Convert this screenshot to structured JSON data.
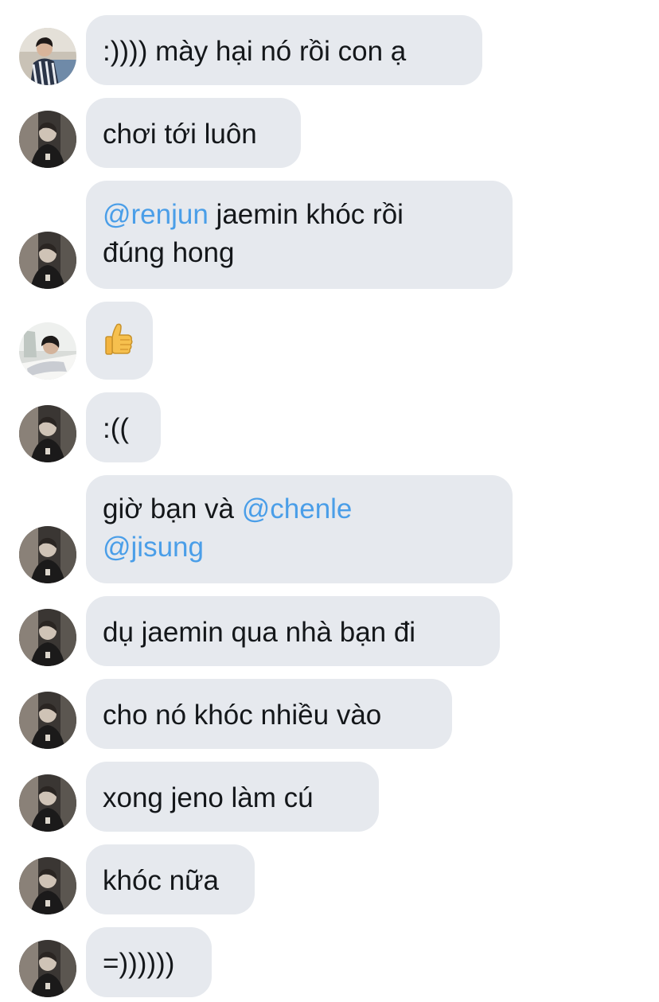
{
  "messages": [
    {
      "avatar": "avatar-user-a",
      "segments": [
        {
          "text": ":)))) mày hại nó rồi con ạ"
        }
      ]
    },
    {
      "avatar": "avatar-user-b",
      "segments": [
        {
          "text": "chơi tới luôn"
        }
      ]
    },
    {
      "avatar": "avatar-user-b",
      "segments": [
        {
          "text": "@renjun",
          "mention": true
        },
        {
          "text": " jaemin khóc rồi"
        },
        {
          "text": "đúng hong",
          "newline": true
        }
      ]
    },
    {
      "avatar": "avatar-user-c",
      "segments": [
        {
          "emoji": "thumbs-up-icon"
        }
      ]
    },
    {
      "avatar": "avatar-user-b",
      "segments": [
        {
          "text": ":(("
        }
      ]
    },
    {
      "avatar": "avatar-user-b",
      "segments": [
        {
          "text": "giờ bạn và "
        },
        {
          "text": "@chenle",
          "mention": true
        },
        {
          "text": "@jisung",
          "mention": true,
          "newline": true
        }
      ]
    },
    {
      "avatar": "avatar-user-b",
      "segments": [
        {
          "text": "dụ jaemin qua nhà bạn đi"
        }
      ]
    },
    {
      "avatar": "avatar-user-b",
      "segments": [
        {
          "text": "cho nó khóc nhiều vào"
        }
      ]
    },
    {
      "avatar": "avatar-user-b",
      "segments": [
        {
          "text": "xong jeno làm cú"
        }
      ]
    },
    {
      "avatar": "avatar-user-b",
      "segments": [
        {
          "text": "khóc nữa"
        }
      ]
    },
    {
      "avatar": "avatar-user-b",
      "segments": [
        {
          "text": "=))))))"
        }
      ]
    }
  ],
  "colors": {
    "bubble": "#e6e9ee",
    "text": "#14171a",
    "mention": "#4a9ee8"
  }
}
